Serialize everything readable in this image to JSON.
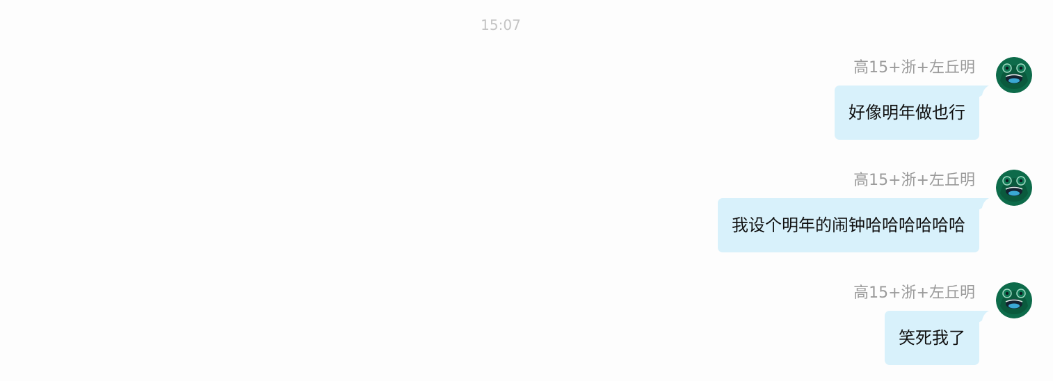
{
  "timestamp": "15:07",
  "colors": {
    "background": "#fdfdfd",
    "bubble": "#d8f1fb",
    "sender_name": "#9a9a9a",
    "timestamp": "#c4c4c4",
    "avatar_bg": "#0d6b4a"
  },
  "messages": [
    {
      "sender": "高15+浙+左丘明",
      "text": "好像明年做也行",
      "avatar_icon": "frog-avatar-icon"
    },
    {
      "sender": "高15+浙+左丘明",
      "text": "我设个明年的闹钟哈哈哈哈哈哈",
      "avatar_icon": "frog-avatar-icon"
    },
    {
      "sender": "高15+浙+左丘明",
      "text": "笑死我了",
      "avatar_icon": "frog-avatar-icon"
    }
  ]
}
